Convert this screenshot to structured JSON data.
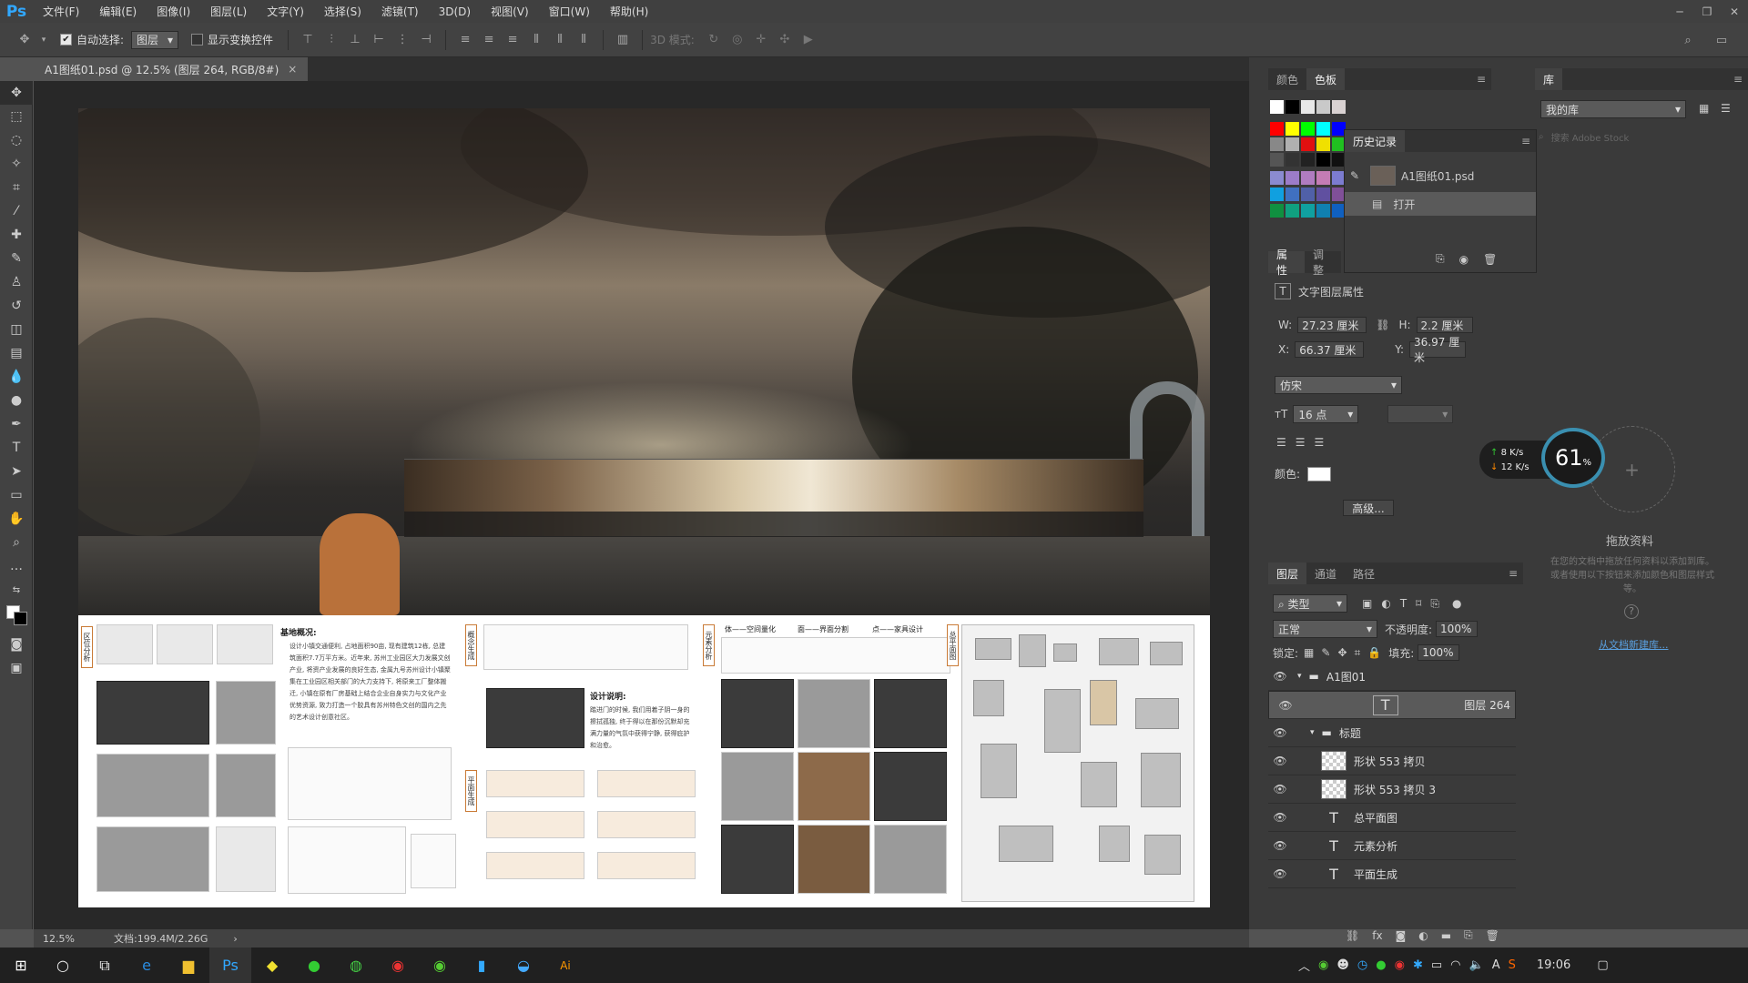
{
  "app": {
    "logo": "Ps",
    "menus": [
      "文件(F)",
      "编辑(E)",
      "图像(I)",
      "图层(L)",
      "文字(Y)",
      "选择(S)",
      "滤镜(T)",
      "3D(D)",
      "视图(V)",
      "窗口(W)",
      "帮助(H)"
    ]
  },
  "options": {
    "auto_select_label": "自动选择:",
    "auto_select_value": "图层",
    "show_transform_label": "显示变换控件",
    "mode_3d_label": "3D 模式:"
  },
  "document": {
    "tab_title": "A1图纸01.psd @ 12.5% (图层 264, RGB/8#)",
    "close_glyph": "×"
  },
  "boards": {
    "site_label": "区位分析",
    "overview_title": "基地概况:",
    "overview_text": "设计小镇交通便利, 占地面积90亩, 现有建筑12栋, 总建筑面积7.7万平方米。近年来, 苏州工业园区大力发展文创产业, 将资产业发展的良好生态, 金属九号苏州设计小镇聚集在工业园区相关部门的大力支持下, 将原来工厂整体搬迁, 小镇在原有厂房基础上结合企业自身实力与文化产业优势资源, 致力打造一个胶具有苏州特色文创的国内之先的艺术设计创意社区。",
    "concept_label": "概念生成",
    "plan_label": "平面生成",
    "element_label": "元素分析",
    "master_label": "总平面图",
    "design_title": "设计说明:",
    "design_text": "踏进门的时候, 我们用着子阴一身的擦拭孤独, 终于得以在那份沉默却充满力量的气氛中获得宁静, 获得庇护和治愈。",
    "elem_headers": [
      "体——空间量化",
      "面——界面分割",
      "点——家具设计"
    ]
  },
  "swatch_panel": {
    "tabs": [
      "颜色",
      "色板"
    ],
    "active": 1
  },
  "history_panel": {
    "title": "历史记录",
    "items": [
      "A1图纸01.psd",
      "打开"
    ]
  },
  "properties_panel": {
    "tabs": [
      "属性",
      "调整"
    ],
    "section": "文字图层属性",
    "w_label": "W:",
    "w_value": "27.23 厘米",
    "h_label": "H:",
    "h_value": "2.2 厘米",
    "x_label": "X:",
    "x_value": "66.37 厘米",
    "y_label": "Y:",
    "y_value": "36.97 厘米",
    "font": "仿宋",
    "size": "16 点",
    "color_label": "颜色:",
    "advanced": "高级..."
  },
  "library_panel": {
    "tab": "库",
    "library": "我的库",
    "search_placeholder": "搜索 Adobe Stock",
    "drop_title": "拖放资料",
    "drop_text": "在您的文档中拖放任何资料以添加到库。或者使用以下按钮来添加颜色和图层样式等。",
    "link": "从文档新建库..."
  },
  "net_widget": {
    "up": "8",
    "down": "12",
    "unit": "K/s",
    "percent": "61",
    "pct_sign": "%"
  },
  "layers_panel": {
    "tabs": [
      "图层",
      "通道",
      "路径"
    ],
    "filter": "类型",
    "blend": "正常",
    "opacity_label": "不透明度:",
    "opacity": "100%",
    "lock_label": "锁定:",
    "fill_label": "填充:",
    "fill": "100%",
    "layers": [
      {
        "name": "A1图01",
        "kind": "group",
        "indent": 0
      },
      {
        "name": "图层 264",
        "kind": "text",
        "indent": 1,
        "selected": true
      },
      {
        "name": "标题",
        "kind": "group",
        "indent": 1
      },
      {
        "name": "形状 553 拷贝",
        "kind": "shape",
        "indent": 2
      },
      {
        "name": "形状 553 拷贝 3",
        "kind": "shape",
        "indent": 2
      },
      {
        "name": "总平面图",
        "kind": "text",
        "indent": 2
      },
      {
        "name": "元素分析",
        "kind": "text",
        "indent": 2
      },
      {
        "name": "平面生成",
        "kind": "text",
        "indent": 2
      }
    ]
  },
  "status": {
    "zoom": "12.5%",
    "doc": "文档:199.4M/2.26G"
  },
  "taskbar": {
    "time": "19:06",
    "ime": "A"
  },
  "colors": {
    "ps_blue": "#31a8ff",
    "accent_orange": "#c97b37"
  }
}
